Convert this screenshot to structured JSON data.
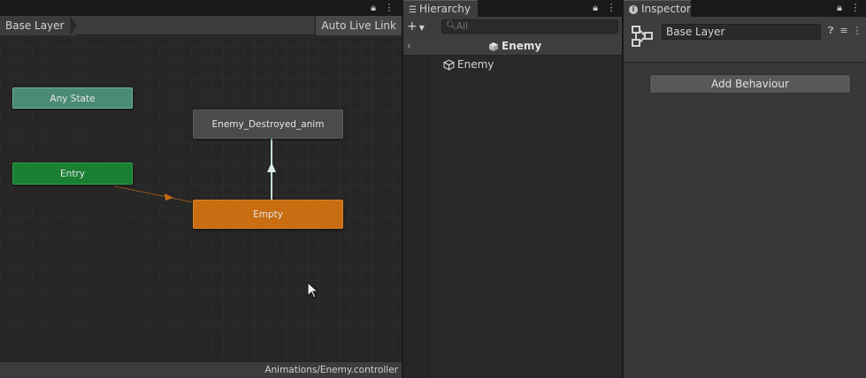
{
  "animator": {
    "breadcrumb": "Base Layer",
    "auto_live_link": "Auto Live Link",
    "footer_path": "Animations/Enemy.controller",
    "states": {
      "any_state": "Any State",
      "entry": "Entry",
      "destroyed": "Enemy_Destroyed_anim",
      "empty": "Empty"
    },
    "colors": {
      "any_state": "#4a8b77",
      "entry": "#1a7f33",
      "default_state": "#c96d12",
      "state": "#4b4b4b",
      "entry_transition": "#c96d12",
      "state_transition": "#bfe0d6"
    }
  },
  "hierarchy": {
    "tab_label": "Hierarchy",
    "search_placeholder": "All",
    "scene_title": "Enemy",
    "items": [
      {
        "label": "Enemy"
      }
    ]
  },
  "inspector": {
    "tab_label": "Inspector",
    "name_value": "Base Layer",
    "add_behaviour_label": "Add Behaviour"
  }
}
